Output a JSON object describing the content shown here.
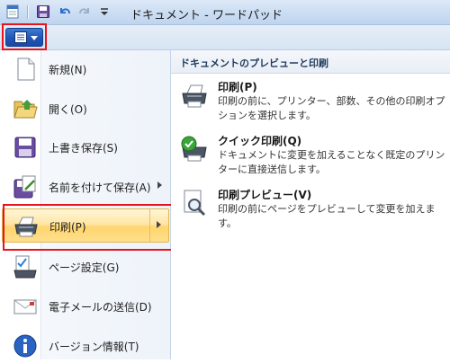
{
  "window": {
    "title": "ドキュメント - ワードパッド"
  },
  "app_menu": {
    "items": [
      {
        "label": "新規(N)",
        "icon": "new-document-icon"
      },
      {
        "label": "開く(O)",
        "icon": "open-folder-icon"
      },
      {
        "label": "上書き保存(S)",
        "icon": "save-disk-icon"
      },
      {
        "label": "名前を付けて保存(A)",
        "icon": "save-as-icon",
        "has_submenu": true
      },
      {
        "label": "印刷(P)",
        "icon": "printer-icon",
        "has_submenu": true,
        "selected": true
      },
      {
        "label": "ページ設定(G)",
        "icon": "page-setup-icon"
      },
      {
        "label": "電子メールの送信(D)",
        "icon": "email-icon"
      },
      {
        "label": "バージョン情報(T)",
        "icon": "info-icon"
      }
    ]
  },
  "submenu": {
    "header": "ドキュメントのプレビューと印刷",
    "options": [
      {
        "title": "印刷(P)",
        "desc": "印刷の前に、プリンター、部数、その他の印刷オプションを選択します。",
        "icon": "printer-icon"
      },
      {
        "title": "クイック印刷(Q)",
        "desc": "ドキュメントに変更を加えることなく既定のプリンターに直接送信します。",
        "icon": "quick-print-icon"
      },
      {
        "title": "印刷プレビュー(V)",
        "desc": "印刷の前にページをプレビューして変更を加えます。",
        "icon": "print-preview-icon"
      }
    ]
  },
  "colors": {
    "highlight_frame": "#e8141b",
    "selection": "#ffdf8e",
    "app_button": "#1f56b5"
  }
}
